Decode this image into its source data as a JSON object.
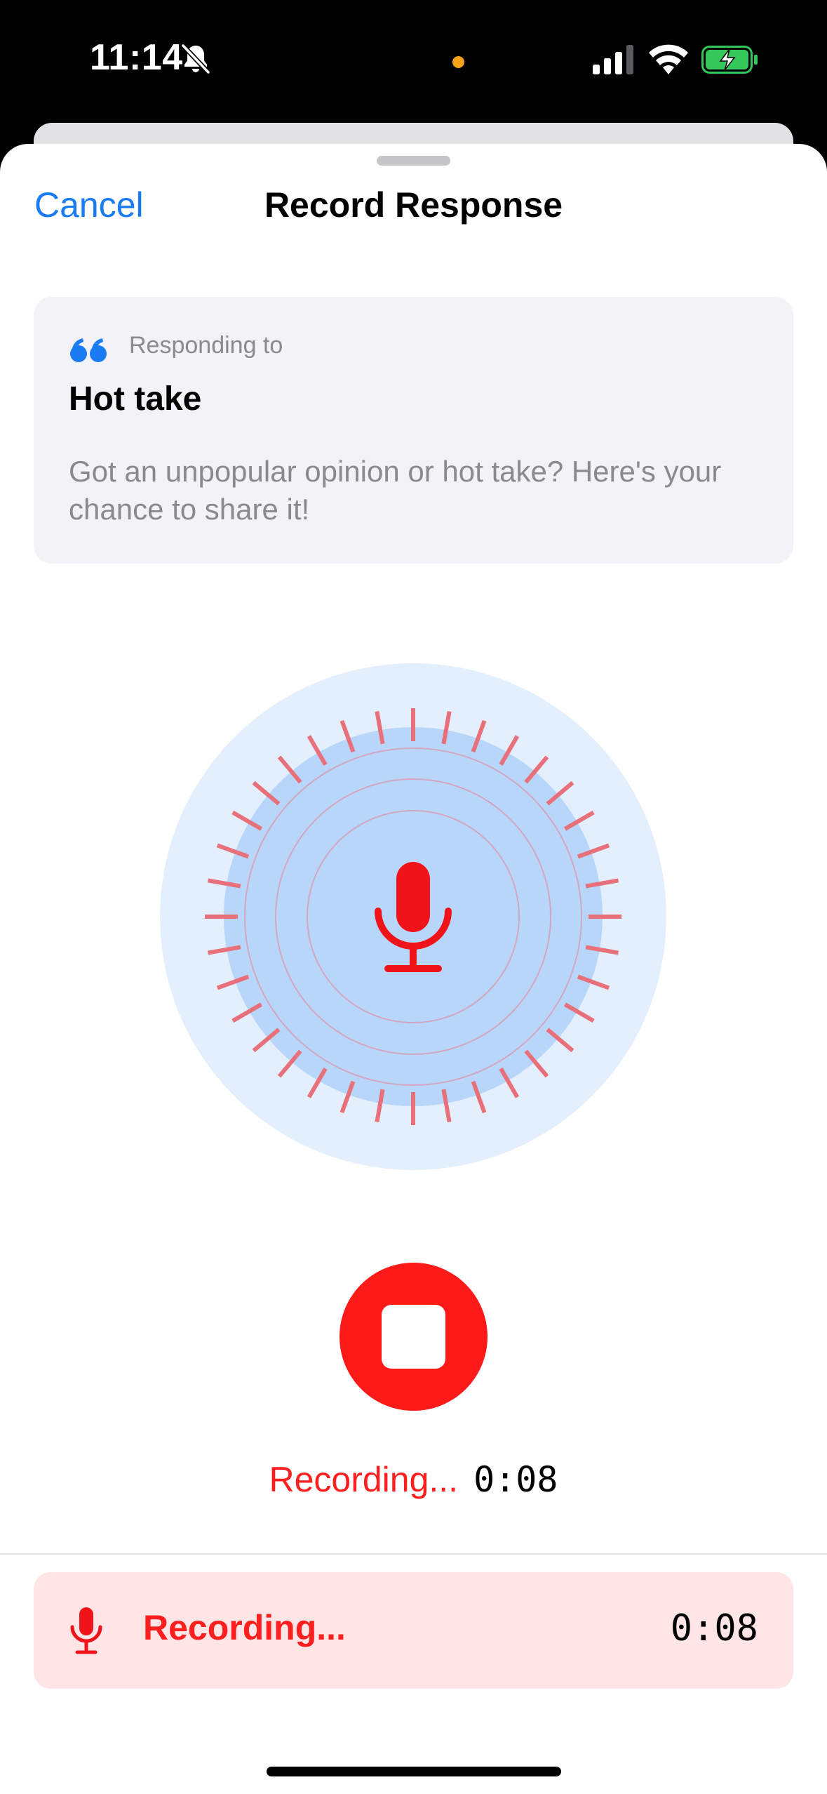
{
  "status_bar": {
    "time": "11:14"
  },
  "header": {
    "cancel_label": "Cancel",
    "title": "Record Response"
  },
  "prompt_card": {
    "label": "Responding to",
    "title": "Hot take",
    "description": "Got an unpopular opinion or hot take? Here's your chance to share it!"
  },
  "recorder": {
    "status_label": "Recording...",
    "elapsed": "0:08"
  },
  "bottom_bar": {
    "status_label": "Recording...",
    "elapsed": "0:08"
  },
  "colors": {
    "accent_blue": "#1a7cf5",
    "record_red": "#ff1a1a",
    "pulse_outer": "#e3effd",
    "pulse_inner": "#b8d6fa",
    "tick_red": "#e8707a"
  }
}
